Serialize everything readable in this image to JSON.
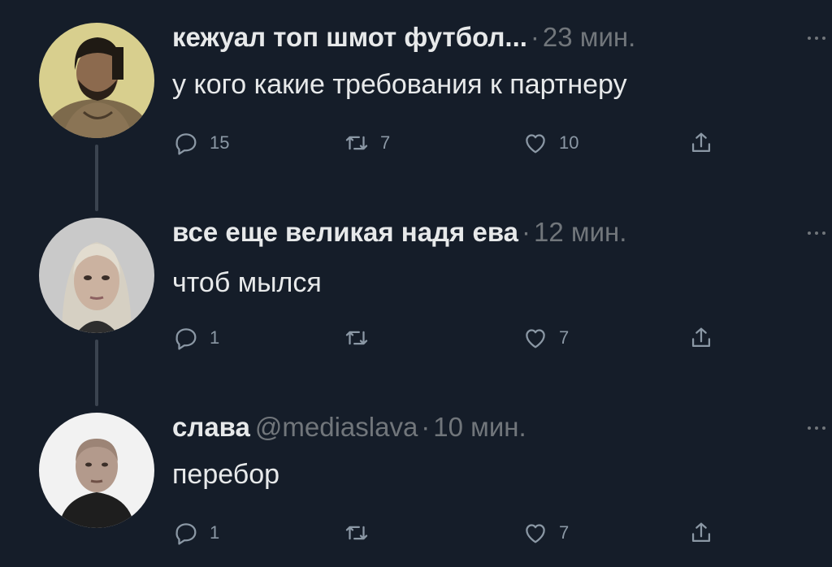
{
  "tweets": [
    {
      "name": "кежуал топ шмот футбол...",
      "handle": "",
      "separator": "·",
      "time": "23 мин.",
      "text": "у кого какие требования к партнеру",
      "actions": {
        "reply_count": "15",
        "retweet_count": "7",
        "like_count": "10",
        "share_count": ""
      }
    },
    {
      "name": "все еще великая надя ева",
      "handle": "",
      "separator": "·",
      "time": "12 мин.",
      "text": "чтоб мылся",
      "actions": {
        "reply_count": "1",
        "retweet_count": "",
        "like_count": "7",
        "share_count": ""
      }
    },
    {
      "name": "слава",
      "handle": "@mediaslava",
      "separator": "·",
      "time": "10 мин.",
      "text": "перебор",
      "actions": {
        "reply_count": "1",
        "retweet_count": "",
        "like_count": "7",
        "share_count": ""
      }
    }
  ],
  "icons": {
    "reply": "reply-icon",
    "retweet": "retweet-icon",
    "like": "heart-icon",
    "share": "share-icon",
    "more": "more-icon"
  },
  "colors": {
    "background": "#151d29",
    "text_primary": "#e7e9ea",
    "text_secondary": "#71767b",
    "icon": "#8b98a5",
    "thread_line": "#3b4450"
  }
}
